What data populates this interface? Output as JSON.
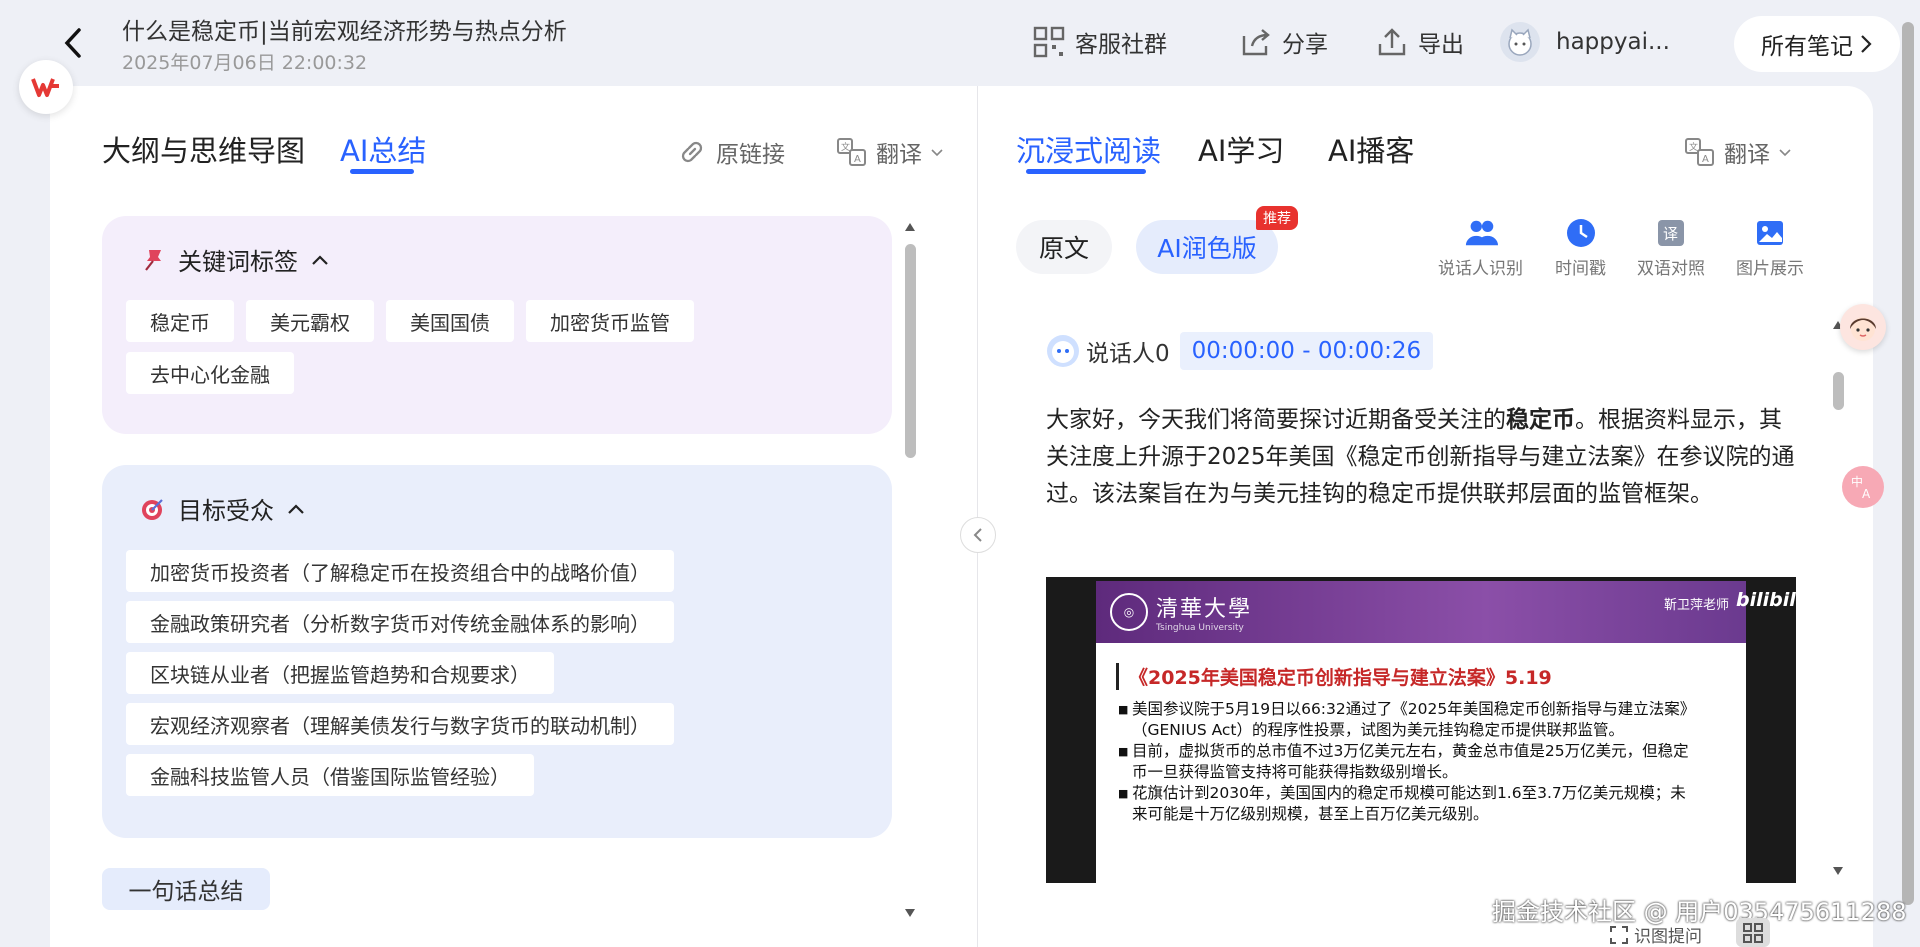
{
  "header": {
    "title": "什么是稳定币|当前宏观经济形势与热点分析",
    "datetime": "2025年07月06日 22:00:32",
    "actions": {
      "community": "客服社群",
      "share": "分享",
      "export": "导出",
      "username": "happyai...",
      "all_notes": "所有笔记"
    }
  },
  "left": {
    "tabs": [
      "大纲与思维导图",
      "AI总结"
    ],
    "active_tab": "AI总结",
    "source_link": "原链接",
    "translate": "翻译",
    "keywords": {
      "title": "关键词标签",
      "tags": [
        "稳定币",
        "美元霸权",
        "美国国债",
        "加密货币监管",
        "去中心化金融"
      ]
    },
    "audience": {
      "title": "目标受众",
      "items": [
        "加密货币投资者（了解稳定币在投资组合中的战略价值）",
        "金融政策研究者（分析数字货币对传统金融体系的影响）",
        "区块链从业者（把握监管趋势和合规要求）",
        "宏观经济观察者（理解美债发行与数字货币的联动机制）",
        "金融科技监管人员（借鉴国际监管经验）"
      ]
    },
    "summary_button": "一句话总结"
  },
  "right": {
    "tabs": [
      "沉浸式阅读",
      "AI学习",
      "AI播客"
    ],
    "active_tab": "沉浸式阅读",
    "translate": "翻译",
    "modes": {
      "original": "原文",
      "polished": "AI润色版",
      "badge": "推荐"
    },
    "tools": [
      "说话人识别",
      "时间戳",
      "双语对照",
      "图片展示"
    ],
    "speaker": "说话人0",
    "timestamp": "00:00:00 - 00:00:26",
    "paragraph": {
      "pre": "大家好，今天我们将简要探讨近期备受关注的",
      "bold": "稳定币",
      "post": "。根据资料显示，其关注度上升源于2025年美国《稳定币创新指导与建立法案》在参议院的通过。该法案旨在为与美元挂钩的稳定币提供联邦层面的监管框架。"
    },
    "slide": {
      "university_cn": "清華大學",
      "university_en": "Tsinghua University",
      "teacher": "靳卫萍老师",
      "platform": "bilibili",
      "title": "《2025年美国稳定币创新指导与建立法案》5.19",
      "bullets": [
        "美国参议院于5月19日以66:32通过了《2025年美国稳定币创新指导与建立法案》（GENIUS Act）的程序性投票，试图为美元挂钩稳定币提供联邦监管。",
        "目前，虚拟货币的总市值不过3万亿美元左右，黄金总市值是25万亿美元，但稳定币一旦获得监管支持将可能获得指数级别增长。",
        "花旗估计到2030年，美国国内的稳定币规模可能达到1.6至3.7万亿美元规模；未来可能是十万亿级别规模，甚至上百万亿美元级别。"
      ]
    }
  },
  "overlay": {
    "watermark": "掘金技术社区 @ 用户035475611288",
    "ask_label": "识图提问"
  }
}
